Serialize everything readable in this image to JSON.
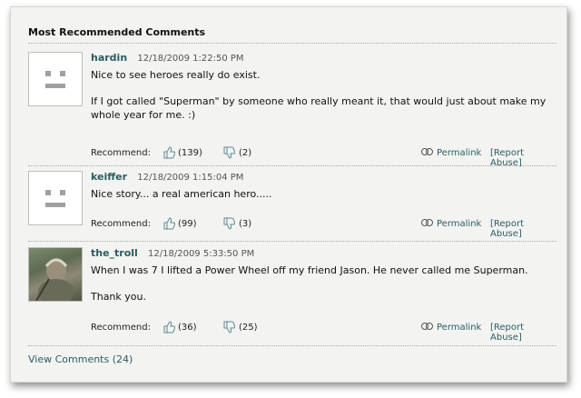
{
  "section": {
    "title": "Most Recommended Comments",
    "view_all_label": "View Comments (24)"
  },
  "actions": {
    "recommend_label": "Recommend:",
    "permalink_label": "Permalink",
    "report_label": "[Report Abuse]"
  },
  "comments": [
    {
      "author": "hardin",
      "timestamp": "12/18/2009 1:22:50 PM",
      "paragraphs": [
        "Nice to see heroes really do exist.",
        "If I got called \"Superman\" by someone who really meant it, that would just about make my whole year for me. :)"
      ],
      "up": "(139)",
      "down": "(2)",
      "avatar": "default-avatar"
    },
    {
      "author": "keiffer",
      "timestamp": "12/18/2009 1:15:04 PM",
      "paragraphs": [
        "Nice story... a real american hero....."
      ],
      "up": "(99)",
      "down": "(3)",
      "avatar": "default-avatar"
    },
    {
      "author": "the_troll",
      "timestamp": "12/18/2009 5:33:50 PM",
      "paragraphs": [
        "When I was 7 I lifted a Power Wheel off my friend Jason. He never called me Superman.",
        "Thank you."
      ],
      "up": "(36)",
      "down": "(25)",
      "avatar": "troll-photo-avatar"
    }
  ],
  "icons": {
    "thumbs_up": "thumbs-up-icon",
    "thumbs_down": "thumbs-down-icon",
    "link": "chain-link-icon"
  },
  "colors": {
    "author": "#2a5d62",
    "link": "#2a5d62",
    "icon": "#5b8a95",
    "background": "#f3f3f1"
  }
}
